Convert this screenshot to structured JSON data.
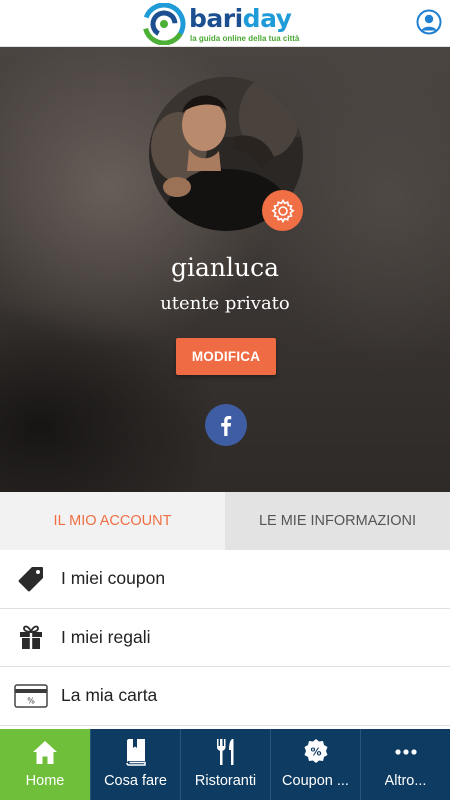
{
  "header": {
    "logo_word_part1": "bari",
    "logo_word_part2": "day",
    "logo_tagline": "la guida online della tua città",
    "profile_icon": "user-circle-icon"
  },
  "profile": {
    "username": "gianluca",
    "user_type": "utente privato",
    "edit_label": "MODIFICA",
    "settings_icon": "gear-icon",
    "facebook_icon": "facebook-icon"
  },
  "tabs": [
    {
      "label": "IL MIO ACCOUNT",
      "active": true
    },
    {
      "label": "LE MIE INFORMAZIONI",
      "active": false
    }
  ],
  "menu": [
    {
      "label": "I miei coupon",
      "icon": "tag-icon"
    },
    {
      "label": "I miei regali",
      "icon": "gift-icon"
    },
    {
      "label": "La mia carta",
      "icon": "card-icon"
    }
  ],
  "bottom_nav": [
    {
      "label": "Home",
      "icon": "home-icon",
      "active": true
    },
    {
      "label": "Cosa fare",
      "icon": "book-icon",
      "active": false
    },
    {
      "label": "Ristoranti",
      "icon": "fork-knife-icon",
      "active": false
    },
    {
      "label": "Coupon ...",
      "icon": "percent-badge-icon",
      "active": false
    },
    {
      "label": "Altro...",
      "icon": "more-dots-icon",
      "active": false
    }
  ],
  "colors": {
    "accent": "#f06f45",
    "brand_dark": "#1c4f8f",
    "brand_light": "#1f9bd8",
    "nav_bg": "#0d3b61",
    "nav_active": "#6fbf3a",
    "facebook": "#3f5da3"
  }
}
